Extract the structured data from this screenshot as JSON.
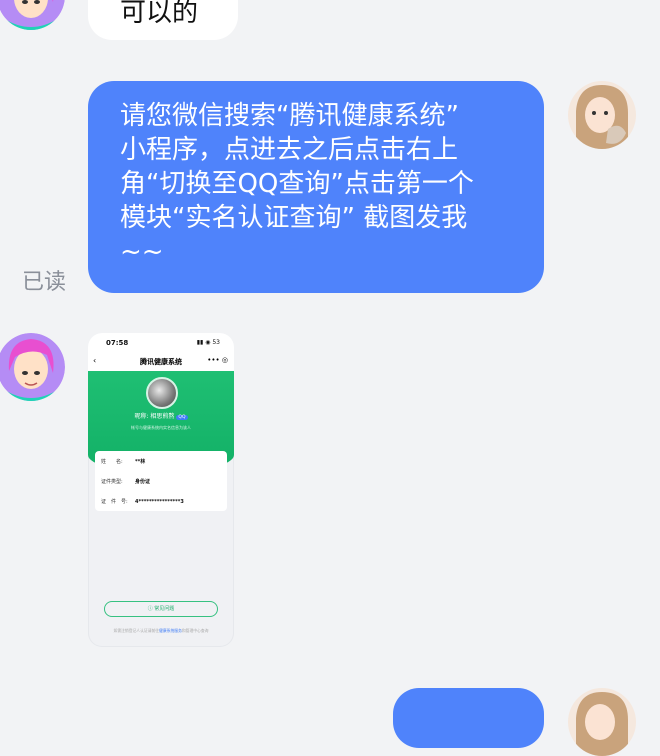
{
  "messages": {
    "m1_text": "可以的",
    "m2_lines": [
      "请您微信搜索“腾讯健康系统”",
      "小程序，点进去之后点击右上",
      "角“切换至QQ查询”点击第一个",
      "模块“实名认证查询” 截图发我",
      "~~"
    ],
    "m2_status": "已读"
  },
  "screenshot": {
    "time": "07:58",
    "battery": "53",
    "title": "腾讯健康系统",
    "nickname": "昵称: 相思煎熬",
    "tag": "QQ",
    "hint": "帐号与健康系统内实名信息为该人",
    "rows": [
      {
        "k": "姓　　名:",
        "v": "**林"
      },
      {
        "k": "证件类型:",
        "v": "身份证"
      },
      {
        "k": "证　件　号:",
        "v": "4****************3"
      }
    ],
    "faq": "常见问题",
    "foot_a": "如需注销登记人认证请前往",
    "foot_link": "健康系统服务",
    "foot_b": "和管理中心查询"
  },
  "colors": {
    "accent": "#4f83fb",
    "hero": "#1fbf73"
  }
}
